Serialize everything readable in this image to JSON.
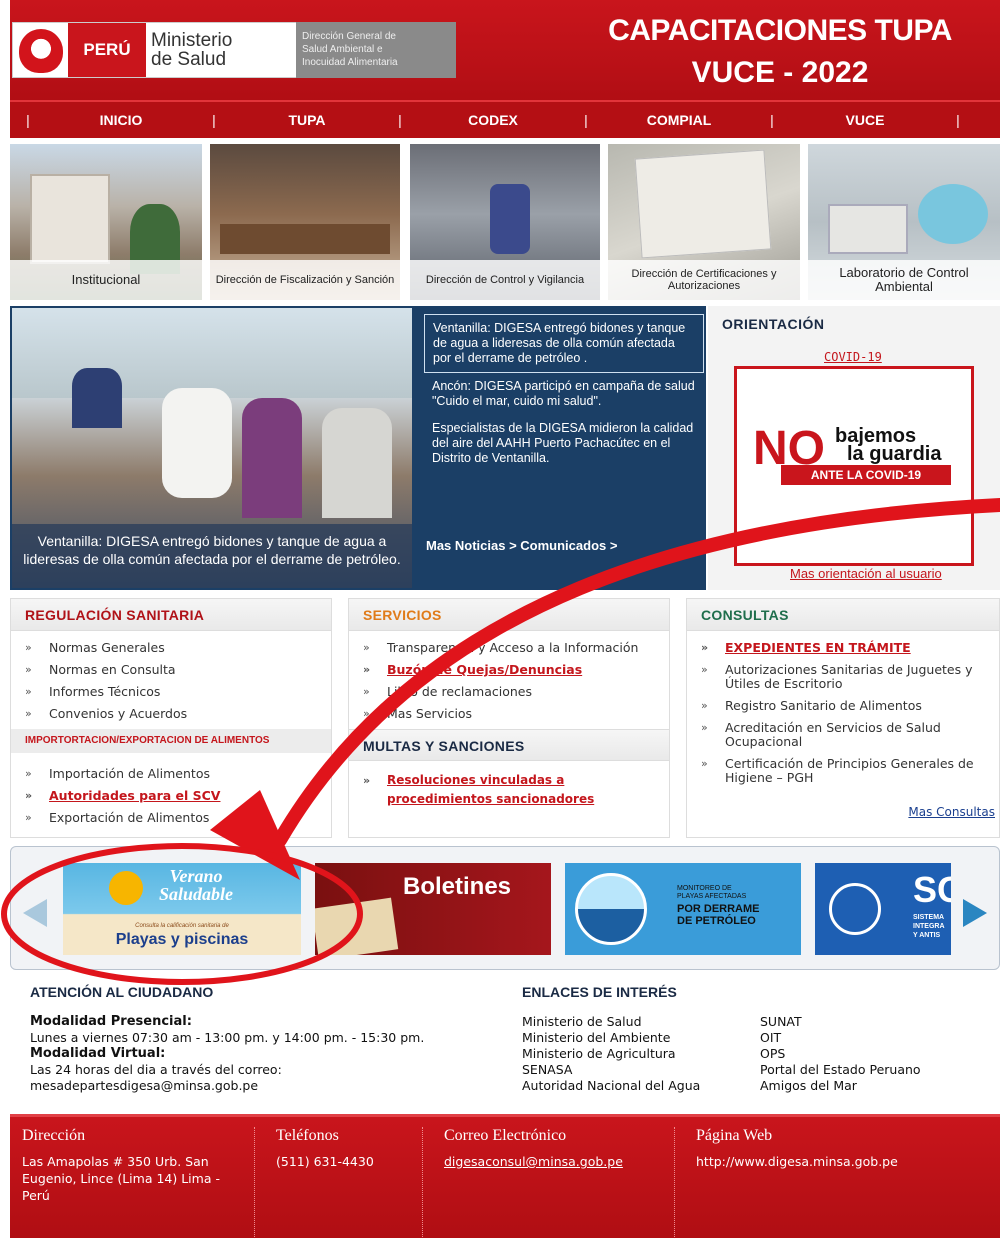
{
  "header": {
    "country": "PERÚ",
    "ministry_line1": "Ministerio",
    "ministry_line2": "de Salud",
    "digesa_lines": [
      "Dirección General de",
      "Salud Ambiental e",
      "Inocuidad Alimentaria"
    ],
    "title_line1": "CAPACITACIONES TUPA",
    "title_line2": "VUCE - 2022"
  },
  "nav": {
    "items": [
      "INICIO",
      "TUPA",
      "CODEX",
      "COMPIAL",
      "VUCE"
    ],
    "separator": "|"
  },
  "tiles": [
    "Institucional",
    "Dirección de Fiscalización y Sanción",
    "Dirección de Control y Vigilancia",
    "Dirección de Certificaciones y Autorizaciones",
    "Laboratorio de Control Ambiental"
  ],
  "news": {
    "photo_caption": "Ventanilla: DIGESA entregó bidones y tanque de agua a lideresas de olla común afectada por el derrame de petróleo.",
    "items": [
      "Ventanilla: DIGESA entregó bidones y tanque de agua a lideresas de olla común afectada por el derrame de petróleo .",
      "Ancón: DIGESA participó en campaña de salud \"Cuido el mar, cuido mi salud\".",
      "Especialistas de la DIGESA midieron la calidad del aire del AAHH Puerto Pachacútec en el Distrito de Ventanilla."
    ],
    "more_news": "Mas Noticias > Comunicados >"
  },
  "orientacion": {
    "heading": "ORIENTACIÓN",
    "covid_link": "COVID-19",
    "card_no": "NO",
    "card_line1": "bajemos",
    "card_line2": "la guardia",
    "card_ante": "ANTE LA COVID-19",
    "more": "Mas orientación al usuario"
  },
  "regulacion": {
    "heading": "REGULACIÓN SANITARIA",
    "items": [
      "Normas Generales",
      "Normas en Consulta",
      "Informes Técnicos",
      "Convenios y Acuerdos"
    ],
    "sub_heading": "IMPORTORTACION/EXPORTACION DE ALIMENTOS",
    "sub_items": [
      "Importación de Alimentos",
      "Autoridades para el SCV",
      "Exportación de Alimentos"
    ]
  },
  "servicios": {
    "heading": "SERVICIOS",
    "items": [
      "Transparencia y Acceso a la Información",
      "Buzón de Quejas/Denuncias",
      "Libro de reclamaciones",
      "Mas Servicios"
    ],
    "multas_heading": "MULTAS Y SANCIONES",
    "multas_items": [
      "Resoluciones vinculadas a procedimientos sancionadores"
    ]
  },
  "consultas": {
    "heading": "CONSULTAS",
    "items": [
      "EXPEDIENTES EN TRÁMITE",
      "Autorizaciones Sanitarias de Juguetes y Útiles de Escritorio",
      "Registro Sanitario de Alimentos",
      "Acreditación en Servicios de Salud Ocupacional",
      "Certificación de Principios Generales de Higiene – PGH"
    ],
    "more": "Mas Consultas"
  },
  "banners": {
    "verano_line1": "Verano",
    "verano_line2": "Saludable",
    "verano_small": "Consulta la calificación sanitaria de",
    "verano_main": "Playas y piscinas",
    "boletines": "Boletines",
    "monitoreo_line1": "MONITOREO DE",
    "monitoreo_line2": "PLAYAS AFECTADAS",
    "monitoreo_line3": "POR DERRAME",
    "monitoreo_line4": "DE PETRÓLEO",
    "sc_title": "SC",
    "sc_line1": "SISTEMA",
    "sc_line2": "INTEGRA",
    "sc_line3": "Y ANTIS"
  },
  "atencion": {
    "heading": "ATENCIÓN AL CIUDADANO",
    "presencial_label": "Modalidad Presencial",
    "presencial_text": "Lunes a viernes 07:30 am - 13:00 pm. y 14:00 pm. - 15:30 pm.",
    "virtual_label": "Modalidad Virtual",
    "virtual_text": "Las 24 horas del dia a través del correo:",
    "virtual_email": "mesadepartesdigesa@minsa.gob.pe"
  },
  "enlaces": {
    "heading": "ENLACES DE INTERÉS",
    "col1": [
      "Ministerio de Salud",
      "Ministerio del Ambiente",
      "Ministerio de Agricultura",
      "SENASA",
      "Autoridad Nacional del Agua"
    ],
    "col2": [
      "SUNAT",
      "OIT",
      "OPS",
      "Portal del Estado Peruano",
      "Amigos del Mar"
    ]
  },
  "footer": {
    "direccion_label": "Dirección",
    "direccion_text": "Las Amapolas # 350 Urb. San Eugenio, Lince (Lima 14) Lima - Perú",
    "telefonos_label": "Teléfonos",
    "telefonos_text": "(511) 631-4430",
    "correo_label": "Correo Electrónico",
    "correo_text": "digesaconsul@minsa.gob.pe",
    "web_label": "Página Web",
    "web_text": "http://www.digesa.minsa.gob.pe"
  },
  "colors": {
    "brand_red": "#c9151c",
    "nav_red": "#b40f14",
    "news_blue": "#1b3f66",
    "link_red": "#c4161c",
    "annotation_red": "#e0141b"
  }
}
